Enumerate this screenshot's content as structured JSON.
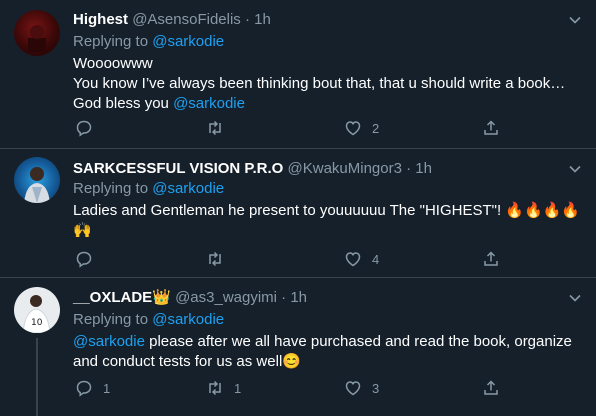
{
  "tweets": [
    {
      "name": "Highest",
      "handle": "@AsensoFidelis",
      "dot": "·",
      "time": "1h",
      "replying_prefix": "Replying to ",
      "replying_to": "@sarkodie",
      "lines": [
        "Woooowww",
        "You know I’ve always been thinking bout that, that u should write a book…"
      ],
      "line3_text": "God bless you ",
      "line3_mention": "@sarkodie",
      "replies": "",
      "retweets": "",
      "likes": "2"
    },
    {
      "name": "SARKCESSFUL VISION P.R.O",
      "handle": "@KwakuMingor3",
      "dot": "·",
      "time": "1h",
      "replying_prefix": "Replying to ",
      "replying_to": "@sarkodie",
      "text": "Ladies and Gentleman he present to youuuuuu The \"HIGHEST\"! ",
      "emojis_fire": "🔥🔥🔥🔥",
      "emojis_hands": "🙌",
      "replies": "",
      "retweets": "",
      "likes": "4"
    },
    {
      "name": "__OXLADE",
      "name_emoji": "👑",
      "handle": "@as3_wagyimi",
      "dot": "·",
      "time": "1h",
      "replying_prefix": "Replying to ",
      "replying_to": "@sarkodie",
      "mention": "@sarkodie",
      "text": " please after we all have purchased and read the book, organize",
      "text2": "and conduct tests for us as well",
      "emoji_end": "😊",
      "replies": "1",
      "retweets": "1",
      "likes": "3"
    }
  ],
  "colors": {
    "background": "#15202b",
    "divider": "#38444d",
    "secondary_text": "#8899a6",
    "link": "#1da1f2"
  }
}
